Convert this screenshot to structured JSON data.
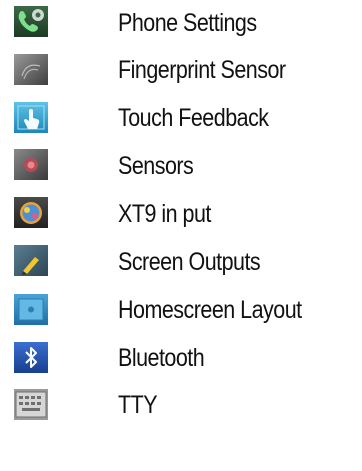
{
  "menu": {
    "items": [
      {
        "label": "Phone Settings",
        "icon": "phone-settings-icon"
      },
      {
        "label": "Fingerprint Sensor",
        "icon": "fingerprint-icon"
      },
      {
        "label": "Touch Feedback",
        "icon": "touch-feedback-icon"
      },
      {
        "label": "Sensors",
        "icon": "sensors-icon"
      },
      {
        "label": "XT9 in put",
        "icon": "xt9-input-icon"
      },
      {
        "label": "Screen Outputs",
        "icon": "screen-outputs-icon"
      },
      {
        "label": "Homescreen Layout",
        "icon": "homescreen-layout-icon"
      },
      {
        "label": "Bluetooth",
        "icon": "bluetooth-icon"
      },
      {
        "label": "TTY",
        "icon": "tty-icon"
      }
    ]
  },
  "colors": {
    "text": "#111111",
    "background": "#ffffff"
  }
}
